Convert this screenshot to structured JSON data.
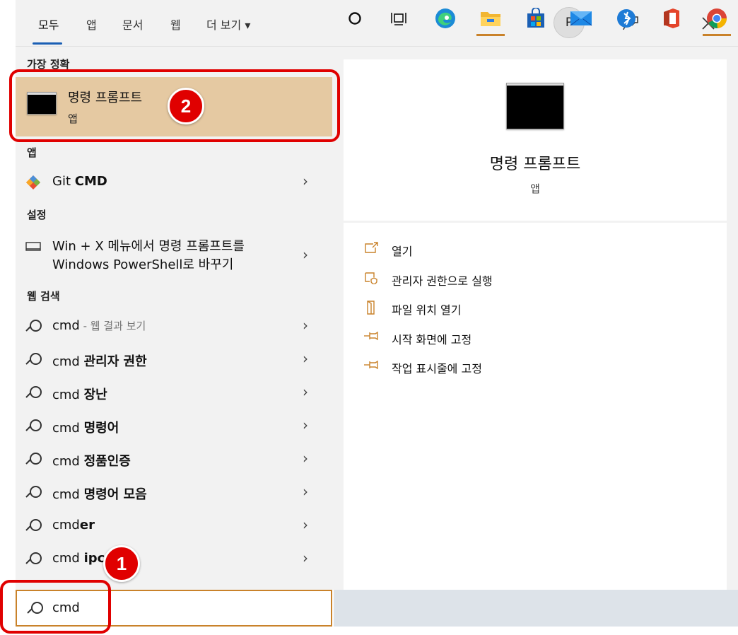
{
  "tabs": [
    {
      "label": "모두"
    },
    {
      "label": "앱"
    },
    {
      "label": "문서"
    },
    {
      "label": "웹"
    },
    {
      "label": "더 보기 ▾"
    }
  ],
  "account": {
    "initial": "P"
  },
  "sections": {
    "best_match": "가장 정확",
    "apps": "앱",
    "settings": "설정",
    "web_search": "웹 검색"
  },
  "best_match": {
    "title": "명령 프롬프트",
    "subtitle": "앱"
  },
  "apps": [
    {
      "prefix": "Git ",
      "bold": "CMD"
    }
  ],
  "settings": [
    {
      "line1": "Win + X 메뉴에서 명령 프롬프트를",
      "line2": "Windows PowerShell로 바꾸기"
    }
  ],
  "web_results": [
    {
      "prefix": "cmd",
      "bold": "",
      "hint": " - 웹 결과 보기"
    },
    {
      "prefix": "cmd ",
      "bold": "관리자 권한",
      "hint": ""
    },
    {
      "prefix": "cmd ",
      "bold": "장난",
      "hint": ""
    },
    {
      "prefix": "cmd ",
      "bold": "명령어",
      "hint": ""
    },
    {
      "prefix": "cmd ",
      "bold": "정품인증",
      "hint": ""
    },
    {
      "prefix": "cmd ",
      "bold": "명령어 모음",
      "hint": ""
    },
    {
      "prefix": "cmd",
      "bold": "er",
      "hint": ""
    },
    {
      "prefix": "cmd ",
      "bold": "ipc",
      "hint": ""
    }
  ],
  "detail": {
    "title": "명령 프롬프트",
    "subtitle": "앱",
    "actions": [
      {
        "label": "열기",
        "icon": "open-icon"
      },
      {
        "label": "관리자 권한으로 실행",
        "icon": "shield-icon"
      },
      {
        "label": "파일 위치 열기",
        "icon": "file-location-icon"
      },
      {
        "label": "시작 화면에 고정",
        "icon": "pin-icon"
      },
      {
        "label": "작업 표시줄에 고정",
        "icon": "pin-icon"
      }
    ]
  },
  "search": {
    "value": "cmd"
  },
  "taskbar": [
    "cortana-icon",
    "task-view-icon",
    "edge-icon",
    "file-explorer-icon",
    "store-icon",
    "mail-icon",
    "bluetooth-share-icon",
    "office-icon",
    "chrome-icon"
  ],
  "annotations": {
    "badge1": "1",
    "badge2": "2"
  },
  "colors": {
    "accent": "#c9822a",
    "highlight": "#e5c9a2",
    "marker": "#e00000"
  }
}
